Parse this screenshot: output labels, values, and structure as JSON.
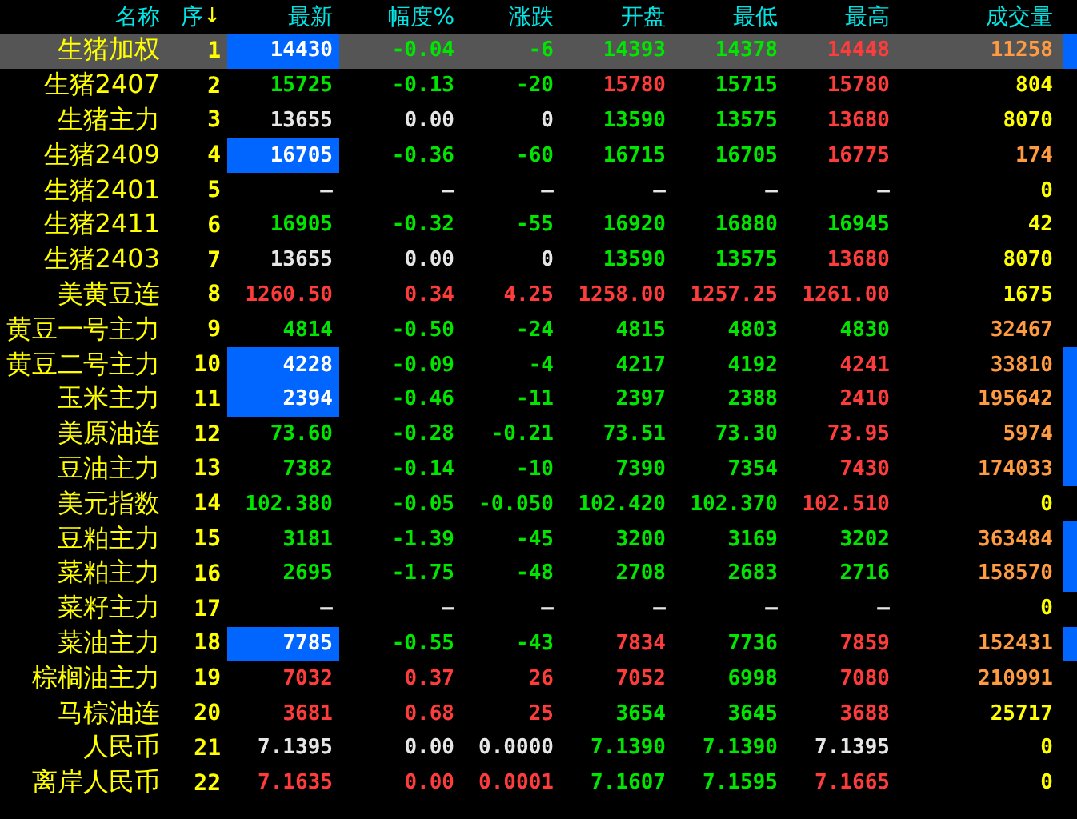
{
  "columns": [
    {
      "label": "名称"
    },
    {
      "label": "序",
      "sort_icon": "↓"
    },
    {
      "label": "最新"
    },
    {
      "label": "幅度%"
    },
    {
      "label": "涨跌"
    },
    {
      "label": "开盘"
    },
    {
      "label": "最低"
    },
    {
      "label": "最高"
    },
    {
      "label": "成交量"
    }
  ],
  "rows": [
    {
      "name": "生猪加权",
      "seq": "1",
      "selected": true,
      "flash": true,
      "marker": true,
      "cells": [
        {
          "text": "14430",
          "color": "#ffffff"
        },
        {
          "text": "-0.04",
          "color": "#00e600"
        },
        {
          "text": "-6",
          "color": "#00e600"
        },
        {
          "text": "14393",
          "color": "#00e600"
        },
        {
          "text": "14378",
          "color": "#00e600"
        },
        {
          "text": "14448",
          "color": "#ff3c3c"
        },
        {
          "text": "11258",
          "color": "#ff9b40"
        }
      ]
    },
    {
      "name": "生猪2407",
      "seq": "2",
      "selected": false,
      "flash": false,
      "marker": false,
      "cells": [
        {
          "text": "15725",
          "color": "#00e600"
        },
        {
          "text": "-0.13",
          "color": "#00e600"
        },
        {
          "text": "-20",
          "color": "#00e600"
        },
        {
          "text": "15780",
          "color": "#ff3c3c"
        },
        {
          "text": "15715",
          "color": "#00e600"
        },
        {
          "text": "15780",
          "color": "#ff3c3c"
        },
        {
          "text": "804",
          "color": "#ffff00"
        }
      ]
    },
    {
      "name": "生猪主力",
      "seq": "3",
      "selected": false,
      "flash": false,
      "marker": false,
      "cells": [
        {
          "text": "13655",
          "color": "#e6e6e6"
        },
        {
          "text": "0.00",
          "color": "#e6e6e6"
        },
        {
          "text": "0",
          "color": "#e6e6e6"
        },
        {
          "text": "13590",
          "color": "#00e600"
        },
        {
          "text": "13575",
          "color": "#00e600"
        },
        {
          "text": "13680",
          "color": "#ff3c3c"
        },
        {
          "text": "8070",
          "color": "#ffff00"
        }
      ]
    },
    {
      "name": "生猪2409",
      "seq": "4",
      "selected": false,
      "flash": true,
      "marker": false,
      "cells": [
        {
          "text": "16705",
          "color": "#ffffff"
        },
        {
          "text": "-0.36",
          "color": "#00e600"
        },
        {
          "text": "-60",
          "color": "#00e600"
        },
        {
          "text": "16715",
          "color": "#00e600"
        },
        {
          "text": "16705",
          "color": "#00e600"
        },
        {
          "text": "16775",
          "color": "#ff3c3c"
        },
        {
          "text": "174",
          "color": "#ff9b40"
        }
      ]
    },
    {
      "name": "生猪2401",
      "seq": "5",
      "selected": false,
      "flash": false,
      "marker": false,
      "cells": [
        {
          "text": "—",
          "color": "#e6e6e6"
        },
        {
          "text": "—",
          "color": "#e6e6e6"
        },
        {
          "text": "—",
          "color": "#e6e6e6"
        },
        {
          "text": "—",
          "color": "#e6e6e6"
        },
        {
          "text": "—",
          "color": "#e6e6e6"
        },
        {
          "text": "—",
          "color": "#e6e6e6"
        },
        {
          "text": "0",
          "color": "#ffff00"
        }
      ]
    },
    {
      "name": "生猪2411",
      "seq": "6",
      "selected": false,
      "flash": false,
      "marker": false,
      "cells": [
        {
          "text": "16905",
          "color": "#00e600"
        },
        {
          "text": "-0.32",
          "color": "#00e600"
        },
        {
          "text": "-55",
          "color": "#00e600"
        },
        {
          "text": "16920",
          "color": "#00e600"
        },
        {
          "text": "16880",
          "color": "#00e600"
        },
        {
          "text": "16945",
          "color": "#00e600"
        },
        {
          "text": "42",
          "color": "#ffff00"
        }
      ]
    },
    {
      "name": "生猪2403",
      "seq": "7",
      "selected": false,
      "flash": false,
      "marker": false,
      "cells": [
        {
          "text": "13655",
          "color": "#e6e6e6"
        },
        {
          "text": "0.00",
          "color": "#e6e6e6"
        },
        {
          "text": "0",
          "color": "#e6e6e6"
        },
        {
          "text": "13590",
          "color": "#00e600"
        },
        {
          "text": "13575",
          "color": "#00e600"
        },
        {
          "text": "13680",
          "color": "#ff3c3c"
        },
        {
          "text": "8070",
          "color": "#ffff00"
        }
      ]
    },
    {
      "name": "美黄豆连",
      "seq": "8",
      "selected": false,
      "flash": false,
      "marker": false,
      "cells": [
        {
          "text": "1260.50",
          "color": "#ff3c3c"
        },
        {
          "text": "0.34",
          "color": "#ff3c3c"
        },
        {
          "text": "4.25",
          "color": "#ff3c3c"
        },
        {
          "text": "1258.00",
          "color": "#ff3c3c"
        },
        {
          "text": "1257.25",
          "color": "#ff3c3c"
        },
        {
          "text": "1261.00",
          "color": "#ff3c3c"
        },
        {
          "text": "1675",
          "color": "#ffff00"
        }
      ]
    },
    {
      "name": "黄豆一号主力",
      "seq": "9",
      "selected": false,
      "flash": false,
      "marker": false,
      "cells": [
        {
          "text": "4814",
          "color": "#00e600"
        },
        {
          "text": "-0.50",
          "color": "#00e600"
        },
        {
          "text": "-24",
          "color": "#00e600"
        },
        {
          "text": "4815",
          "color": "#00e600"
        },
        {
          "text": "4803",
          "color": "#00e600"
        },
        {
          "text": "4830",
          "color": "#00e600"
        },
        {
          "text": "32467",
          "color": "#ff9b40"
        }
      ]
    },
    {
      "name": "黄豆二号主力",
      "seq": "10",
      "selected": false,
      "flash": true,
      "marker": true,
      "cells": [
        {
          "text": "4228",
          "color": "#ffffff"
        },
        {
          "text": "-0.09",
          "color": "#00e600"
        },
        {
          "text": "-4",
          "color": "#00e600"
        },
        {
          "text": "4217",
          "color": "#00e600"
        },
        {
          "text": "4192",
          "color": "#00e600"
        },
        {
          "text": "4241",
          "color": "#ff3c3c"
        },
        {
          "text": "33810",
          "color": "#ff9b40"
        }
      ]
    },
    {
      "name": "玉米主力",
      "seq": "11",
      "selected": false,
      "flash": true,
      "marker": true,
      "cells": [
        {
          "text": "2394",
          "color": "#ffffff"
        },
        {
          "text": "-0.46",
          "color": "#00e600"
        },
        {
          "text": "-11",
          "color": "#00e600"
        },
        {
          "text": "2397",
          "color": "#00e600"
        },
        {
          "text": "2388",
          "color": "#00e600"
        },
        {
          "text": "2410",
          "color": "#ff3c3c"
        },
        {
          "text": "195642",
          "color": "#ff9b40"
        }
      ]
    },
    {
      "name": "美原油连",
      "seq": "12",
      "selected": false,
      "flash": false,
      "marker": true,
      "cells": [
        {
          "text": "73.60",
          "color": "#00e600"
        },
        {
          "text": "-0.28",
          "color": "#00e600"
        },
        {
          "text": "-0.21",
          "color": "#00e600"
        },
        {
          "text": "73.51",
          "color": "#00e600"
        },
        {
          "text": "73.30",
          "color": "#00e600"
        },
        {
          "text": "73.95",
          "color": "#ff3c3c"
        },
        {
          "text": "5974",
          "color": "#ff9b40"
        }
      ]
    },
    {
      "name": "豆油主力",
      "seq": "13",
      "selected": false,
      "flash": false,
      "marker": true,
      "cells": [
        {
          "text": "7382",
          "color": "#00e600"
        },
        {
          "text": "-0.14",
          "color": "#00e600"
        },
        {
          "text": "-10",
          "color": "#00e600"
        },
        {
          "text": "7390",
          "color": "#00e600"
        },
        {
          "text": "7354",
          "color": "#00e600"
        },
        {
          "text": "7430",
          "color": "#ff3c3c"
        },
        {
          "text": "174033",
          "color": "#ff9b40"
        }
      ]
    },
    {
      "name": "美元指数",
      "seq": "14",
      "selected": false,
      "flash": false,
      "marker": false,
      "cells": [
        {
          "text": "102.380",
          "color": "#00e600"
        },
        {
          "text": "-0.05",
          "color": "#00e600"
        },
        {
          "text": "-0.050",
          "color": "#00e600"
        },
        {
          "text": "102.420",
          "color": "#00e600"
        },
        {
          "text": "102.370",
          "color": "#00e600"
        },
        {
          "text": "102.510",
          "color": "#ff3c3c"
        },
        {
          "text": "0",
          "color": "#ffff00"
        }
      ]
    },
    {
      "name": "豆粕主力",
      "seq": "15",
      "selected": false,
      "flash": false,
      "marker": true,
      "cells": [
        {
          "text": "3181",
          "color": "#00e600"
        },
        {
          "text": "-1.39",
          "color": "#00e600"
        },
        {
          "text": "-45",
          "color": "#00e600"
        },
        {
          "text": "3200",
          "color": "#00e600"
        },
        {
          "text": "3169",
          "color": "#00e600"
        },
        {
          "text": "3202",
          "color": "#00e600"
        },
        {
          "text": "363484",
          "color": "#ff9b40"
        }
      ]
    },
    {
      "name": "菜粕主力",
      "seq": "16",
      "selected": false,
      "flash": false,
      "marker": true,
      "cells": [
        {
          "text": "2695",
          "color": "#00e600"
        },
        {
          "text": "-1.75",
          "color": "#00e600"
        },
        {
          "text": "-48",
          "color": "#00e600"
        },
        {
          "text": "2708",
          "color": "#00e600"
        },
        {
          "text": "2683",
          "color": "#00e600"
        },
        {
          "text": "2716",
          "color": "#00e600"
        },
        {
          "text": "158570",
          "color": "#ff9b40"
        }
      ]
    },
    {
      "name": "菜籽主力",
      "seq": "17",
      "selected": false,
      "flash": false,
      "marker": false,
      "cells": [
        {
          "text": "—",
          "color": "#e6e6e6"
        },
        {
          "text": "—",
          "color": "#e6e6e6"
        },
        {
          "text": "—",
          "color": "#e6e6e6"
        },
        {
          "text": "—",
          "color": "#e6e6e6"
        },
        {
          "text": "—",
          "color": "#e6e6e6"
        },
        {
          "text": "—",
          "color": "#e6e6e6"
        },
        {
          "text": "0",
          "color": "#ffff00"
        }
      ]
    },
    {
      "name": "菜油主力",
      "seq": "18",
      "selected": false,
      "flash": true,
      "marker": true,
      "cells": [
        {
          "text": "7785",
          "color": "#ffffff"
        },
        {
          "text": "-0.55",
          "color": "#00e600"
        },
        {
          "text": "-43",
          "color": "#00e600"
        },
        {
          "text": "7834",
          "color": "#ff3c3c"
        },
        {
          "text": "7736",
          "color": "#00e600"
        },
        {
          "text": "7859",
          "color": "#ff3c3c"
        },
        {
          "text": "152431",
          "color": "#ff9b40"
        }
      ]
    },
    {
      "name": "棕榈油主力",
      "seq": "19",
      "selected": false,
      "flash": false,
      "marker": false,
      "cells": [
        {
          "text": "7032",
          "color": "#ff3c3c"
        },
        {
          "text": "0.37",
          "color": "#ff3c3c"
        },
        {
          "text": "26",
          "color": "#ff3c3c"
        },
        {
          "text": "7052",
          "color": "#ff3c3c"
        },
        {
          "text": "6998",
          "color": "#00e600"
        },
        {
          "text": "7080",
          "color": "#ff3c3c"
        },
        {
          "text": "210991",
          "color": "#ff9b40"
        }
      ]
    },
    {
      "name": "马棕油连",
      "seq": "20",
      "selected": false,
      "flash": false,
      "marker": false,
      "cells": [
        {
          "text": "3681",
          "color": "#ff3c3c"
        },
        {
          "text": "0.68",
          "color": "#ff3c3c"
        },
        {
          "text": "25",
          "color": "#ff3c3c"
        },
        {
          "text": "3654",
          "color": "#00e600"
        },
        {
          "text": "3645",
          "color": "#00e600"
        },
        {
          "text": "3688",
          "color": "#ff3c3c"
        },
        {
          "text": "25717",
          "color": "#ffff00"
        }
      ]
    },
    {
      "name": "人民币",
      "seq": "21",
      "selected": false,
      "flash": false,
      "marker": false,
      "cells": [
        {
          "text": "7.1395",
          "color": "#e6e6e6"
        },
        {
          "text": "0.00",
          "color": "#e6e6e6"
        },
        {
          "text": "0.0000",
          "color": "#e6e6e6"
        },
        {
          "text": "7.1390",
          "color": "#00e600"
        },
        {
          "text": "7.1390",
          "color": "#00e600"
        },
        {
          "text": "7.1395",
          "color": "#e6e6e6"
        },
        {
          "text": "0",
          "color": "#ffff00"
        }
      ]
    },
    {
      "name": "离岸人民币",
      "seq": "22",
      "selected": false,
      "flash": false,
      "marker": false,
      "cells": [
        {
          "text": "7.1635",
          "color": "#ff3c3c"
        },
        {
          "text": "0.00",
          "color": "#ff3c3c"
        },
        {
          "text": "0.0001",
          "color": "#ff3c3c"
        },
        {
          "text": "7.1607",
          "color": "#00e600"
        },
        {
          "text": "7.1595",
          "color": "#00e600"
        },
        {
          "text": "7.1665",
          "color": "#ff3c3c"
        },
        {
          "text": "0",
          "color": "#ffff00"
        }
      ]
    }
  ]
}
